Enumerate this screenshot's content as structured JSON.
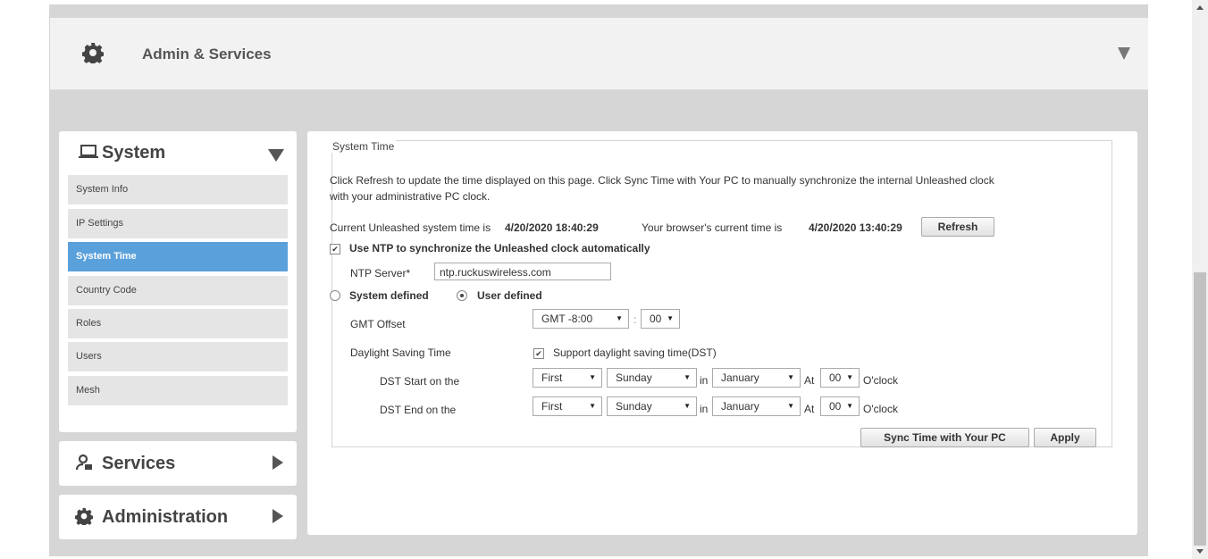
{
  "header": {
    "title": "Admin & Services",
    "gear_icon": "gear-icon",
    "collapse_icon": "caret-down-icon"
  },
  "sidebar": {
    "system": {
      "label": "System",
      "icon": "laptop-icon"
    },
    "items": [
      {
        "label": "System Info",
        "active": false
      },
      {
        "label": "IP Settings",
        "active": false
      },
      {
        "label": "System Time",
        "active": true
      },
      {
        "label": "Country Code",
        "active": false
      },
      {
        "label": "Roles",
        "active": false
      },
      {
        "label": "Users",
        "active": false
      },
      {
        "label": "Mesh",
        "active": false
      }
    ],
    "services": {
      "label": "Services",
      "icon": "services-icon"
    },
    "administration": {
      "label": "Administration",
      "icon": "gear-icon"
    }
  },
  "system_time": {
    "legend": "System Time",
    "intro_line1": "Click Refresh to update the time displayed on this page. Click Sync Time with Your PC to manually synchronize the internal Unleashed clock",
    "intro_line2": "with your administrative PC clock.",
    "current_prefix": "Current Unleashed system time is",
    "system_time_value": "4/20/2020 18:40:29",
    "browser_prefix": "Your browser's current time is",
    "browser_time_value": "4/20/2020 13:40:29",
    "refresh_label": "Refresh",
    "ntp_check_label": "Use NTP to synchronize the Unleashed clock automatically",
    "ntp_checked": true,
    "ntp_server_label": "NTP Server*",
    "ntp_server_value": "ntp.ruckuswireless.com",
    "system_defined_label": "System defined",
    "user_defined_label": "User defined",
    "selected_mode": "User defined",
    "gmt_offset_label": "GMT Offset",
    "gmt_offset_value": "GMT -8:00",
    "gmt_minutes_sep": ":",
    "gmt_minutes_value": "00",
    "dst_label": "Daylight Saving Time",
    "dst_support_label": "Support daylight saving time(DST)",
    "dst_checked": true,
    "dst_start_label": "DST Start on the",
    "dst_end_label": "DST End on the",
    "dst_start": {
      "week": "First",
      "day": "Sunday",
      "in_label": "in",
      "month": "January",
      "at_label": "At",
      "hour": "00",
      "oclock": "O'clock"
    },
    "dst_end": {
      "week": "First",
      "day": "Sunday",
      "in_label": "in",
      "month": "January",
      "at_label": "At",
      "hour": "00",
      "oclock": "O'clock"
    },
    "sync_label": "Sync Time with Your PC",
    "apply_label": "Apply"
  },
  "colors": {
    "active_nav": "#5aa0db",
    "background": "#d6d6d6"
  }
}
